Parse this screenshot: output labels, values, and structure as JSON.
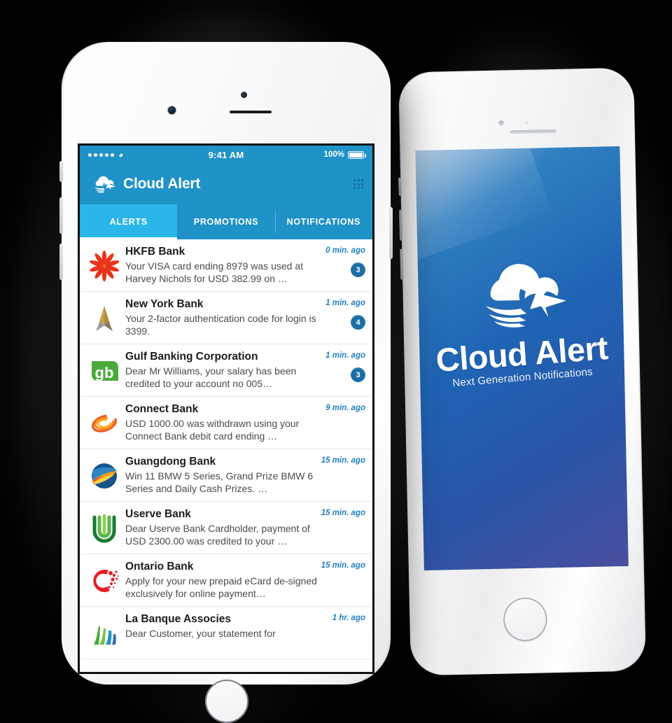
{
  "scene": {
    "background_color": "#000000",
    "device_color": "#ffffff"
  },
  "left_phone": {
    "status_bar": {
      "carrier_dots": 5,
      "wifi_icon": "wifi-icon",
      "time": "9:41 AM",
      "battery_percent": "100%",
      "battery_icon": "battery-full-icon"
    },
    "app_bar": {
      "logo_icon": "cloud-alert-logo-icon",
      "title": "Cloud Alert",
      "menu_icon": "grid-menu-icon",
      "background_color": "#1f92c8"
    },
    "tabs": {
      "active_color": "#29b6e8",
      "items": [
        {
          "label": "ALERTS",
          "active": true
        },
        {
          "label": "PROMOTIONS",
          "active": false
        },
        {
          "label": "NOTIFICATIONS",
          "active": false
        }
      ]
    },
    "alerts": [
      {
        "logo_icon": "hkfb-bank-flower-logo-icon",
        "bank": "HKFB Bank",
        "message": "Your VISA card ending 8979 was used at Harvey Nichols for USD 382.99 on …",
        "time": "0 min. ago",
        "badge": "3"
      },
      {
        "logo_icon": "new-york-bank-chevron-logo-icon",
        "bank": "New York Bank",
        "message": "Your 2-factor authentication code for login is 3399.",
        "time": "1 min. ago",
        "badge": "4"
      },
      {
        "logo_icon": "gulf-banking-gb-leaf-logo-icon",
        "bank": "Gulf Banking Corporation",
        "message": "Dear Mr Williams, your salary has been credited to your account no 005…",
        "time": "1 min. ago",
        "badge": "3"
      },
      {
        "logo_icon": "connect-bank-swirl-logo-icon",
        "bank": "Connect Bank",
        "message": "USD 1000.00 was withdrawn using your Connect Bank debit card ending …",
        "time": "9 min. ago",
        "badge": ""
      },
      {
        "logo_icon": "guangdong-bank-globe-logo-icon",
        "bank": "Guangdong Bank",
        "message": "Win 11 BMW 5 Series, Grand Prize BMW 6 Series and Daily Cash Prizes. …",
        "time": "15 min. ago",
        "badge": ""
      },
      {
        "logo_icon": "userve-bank-green-u-logo-icon",
        "bank": "Userve Bank",
        "message": "Dear Userve Bank Cardholder, payment of USD 2300.00 was credited to your …",
        "time": "15 min. ago",
        "badge": ""
      },
      {
        "logo_icon": "ontario-bank-red-o-logo-icon",
        "bank": "Ontario Bank",
        "message": "Apply for your new prepaid eCard de-signed exclusively for online payment…",
        "time": "15 min. ago",
        "badge": ""
      },
      {
        "logo_icon": "la-banque-associes-logo-icon",
        "bank": "La Banque Associes",
        "message": "Dear Customer, your statement for",
        "time": "1 hr. ago",
        "badge": ""
      }
    ]
  },
  "right_phone": {
    "splash": {
      "logo_icon": "cloud-alert-logo-icon",
      "brand": "Cloud Alert",
      "tagline": "Next Generation Notifications",
      "gradient_from": "#2f7fc0",
      "gradient_to": "#4a4f9e"
    }
  }
}
